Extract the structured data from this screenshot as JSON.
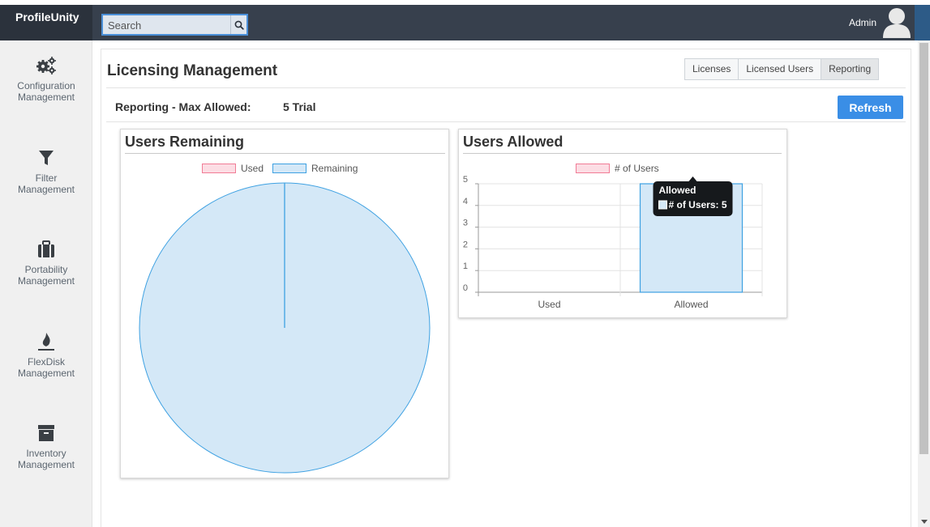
{
  "app": {
    "brand": "ProfileUnity"
  },
  "search": {
    "placeholder": "Search"
  },
  "user": {
    "name": "Admin"
  },
  "sidebar": {
    "items": [
      {
        "line1": "Configuration",
        "line2": "Management",
        "icon": "gears-icon"
      },
      {
        "line1": "Filter",
        "line2": "Management",
        "icon": "filter-icon"
      },
      {
        "line1": "Portability",
        "line2": "Management",
        "icon": "briefcase-icon"
      },
      {
        "line1": "FlexDisk",
        "line2": "Management",
        "icon": "flexdisk-icon"
      },
      {
        "line1": "Inventory",
        "line2": "Management",
        "icon": "archive-icon"
      }
    ]
  },
  "page": {
    "title": "Licensing Management",
    "tabs": [
      "Licenses",
      "Licensed Users",
      "Reporting"
    ],
    "active_tab": "Reporting",
    "reporting_label": "Reporting - Max Allowed:",
    "reporting_value": "5 Trial",
    "refresh_label": "Refresh"
  },
  "colors": {
    "topbar": "#37404d",
    "accent": "#3a8ee6",
    "used_fill": "#fcdde4",
    "used_border": "#f17c96",
    "remaining_fill": "#d4e8f7",
    "remaining_border": "#3ea1e2"
  },
  "chart_data": [
    {
      "type": "pie",
      "title": "Users Remaining",
      "labels": [
        "Used",
        "Remaining"
      ],
      "values": [
        0,
        5
      ],
      "legend": "top"
    },
    {
      "type": "bar",
      "title": "Users Allowed",
      "categories": [
        "Used",
        "Allowed"
      ],
      "series": [
        {
          "name": "# of Users",
          "values": [
            0,
            5
          ]
        }
      ],
      "ylim": [
        0,
        5
      ],
      "yticks": [
        0,
        1,
        2,
        3,
        4,
        5
      ],
      "grid": true,
      "legend": "top",
      "tooltip": {
        "title": "Allowed",
        "label": "# of Users: 5"
      }
    }
  ]
}
